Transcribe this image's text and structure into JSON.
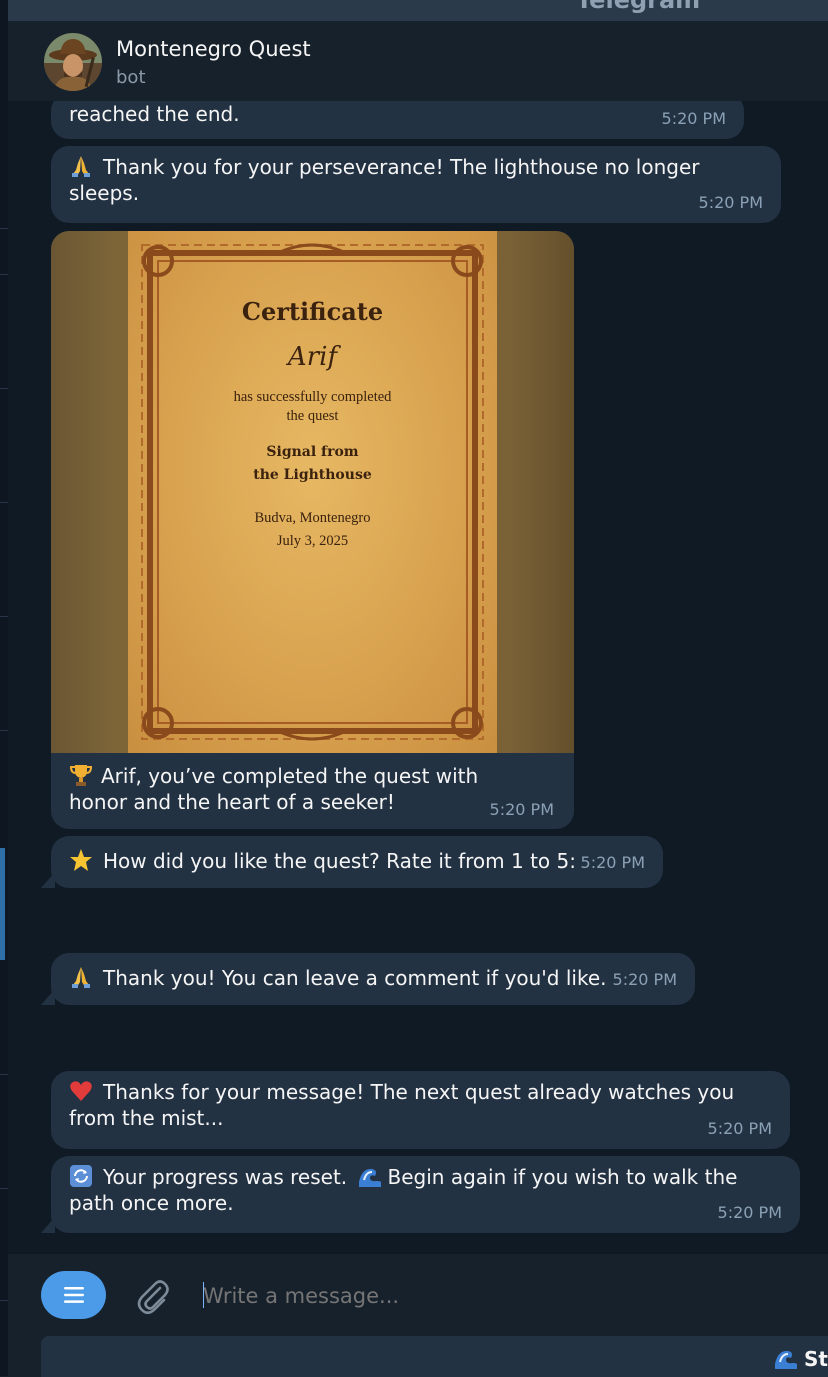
{
  "window": {
    "app_title": "Telegram"
  },
  "header": {
    "chat_name": "Montenegro Quest",
    "chat_status": "bot"
  },
  "messages": [
    {
      "text": "reached the end.",
      "time": "5:20 PM"
    },
    {
      "emoji": "pray",
      "text": "Thank you for your perseverance! The lighthouse no longer sleeps.",
      "time": "5:20 PM"
    },
    {
      "certificate": {
        "title": "Certificate",
        "name": "Arif",
        "line1": "has successfully completed",
        "line2": "the quest",
        "quest1": "Signal from",
        "quest2": "the Lighthouse",
        "place": "Budva, Montenegro",
        "date": "July 3, 2025"
      },
      "emoji": "trophy",
      "text": "Arif, you’ve completed the quest with honor and the heart of a seeker!",
      "time": "5:20 PM"
    },
    {
      "emoji": "star",
      "text": "How did you like the quest? Rate it from 1 to 5:",
      "time": "5:20 PM"
    },
    {
      "emoji": "pray",
      "text": "Thank you! You can leave a comment if you'd like.",
      "time": "5:20 PM"
    },
    {
      "emoji": "heart",
      "text": "Thanks for your message! The next quest already watches you from the mist...",
      "time": "5:20 PM"
    },
    {
      "emoji": "repeat",
      "text": "Your progress was reset.",
      "emoji2": "wave",
      "text2": "Begin again if you wish to walk the path once more.",
      "time": "5:20 PM"
    }
  ],
  "composer": {
    "placeholder": "Write a message...",
    "keyboard_button": "St"
  },
  "colors": {
    "bubble": "#233243",
    "background": "#0f1a25",
    "accent": "#4b9be8"
  }
}
